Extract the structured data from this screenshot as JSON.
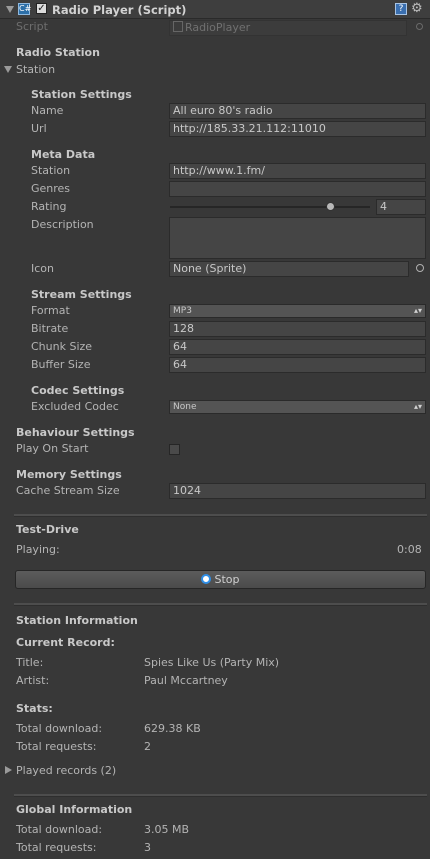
{
  "header": {
    "title": "Radio Player (Script)"
  },
  "script": {
    "label": "Script",
    "value": "RadioPlayer"
  },
  "radio_station": {
    "section_label": "Radio Station",
    "foldout_label": "Station"
  },
  "station_settings": {
    "heading": "Station Settings",
    "name_label": "Name",
    "name_value": "All euro 80's radio",
    "url_label": "Url",
    "url_value": "http://185.33.21.112:11010"
  },
  "meta_data": {
    "heading": "Meta Data",
    "station_label": "Station",
    "station_value": "http://www.1.fm/",
    "genres_label": "Genres",
    "genres_value": "",
    "rating_label": "Rating",
    "rating_value": "4",
    "rating_fraction": 0.8,
    "description_label": "Description",
    "description_value": "",
    "icon_label": "Icon",
    "icon_value": "None (Sprite)"
  },
  "stream_settings": {
    "heading": "Stream Settings",
    "format_label": "Format",
    "format_value": "MP3",
    "bitrate_label": "Bitrate",
    "bitrate_value": "128",
    "chunk_label": "Chunk Size",
    "chunk_value": "64",
    "buffer_label": "Buffer Size",
    "buffer_value": "64"
  },
  "codec_settings": {
    "heading": "Codec Settings",
    "excluded_label": "Excluded Codec",
    "excluded_value": "None"
  },
  "behaviour": {
    "heading": "Behaviour Settings",
    "play_on_start_label": "Play On Start",
    "play_on_start": false
  },
  "memory": {
    "heading": "Memory Settings",
    "cache_label": "Cache Stream Size",
    "cache_value": "1024"
  },
  "test_drive": {
    "heading": "Test-Drive",
    "playing_label": "Playing:",
    "playing_time": "0:08",
    "stop_label": "Stop"
  },
  "station_info": {
    "heading": "Station Information",
    "current_record_label": "Current Record:",
    "title_label": "Title:",
    "title_value": "Spies Like Us (Party Mix)",
    "artist_label": "Artist:",
    "artist_value": "Paul Mccartney",
    "stats_label": "Stats:",
    "total_download_label": "Total download:",
    "total_download_value": "629.38 KB",
    "total_requests_label": "Total requests:",
    "total_requests_value": "2",
    "played_records_label": "Played records (2)"
  },
  "global_info": {
    "heading": "Global Information",
    "total_download_label": "Total download:",
    "total_download_value": "3.05 MB",
    "total_requests_label": "Total requests:",
    "total_requests_value": "3"
  }
}
